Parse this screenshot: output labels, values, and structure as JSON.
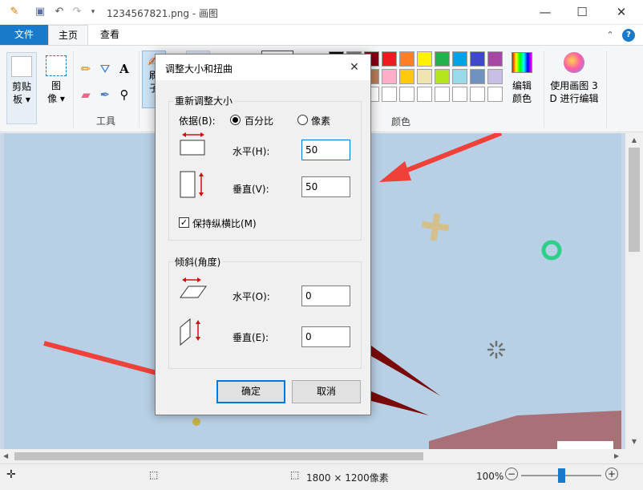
{
  "window": {
    "title": "1234567821.png - 画图",
    "minimize": "—",
    "maximize": "☐",
    "close": "✕"
  },
  "tabs": {
    "file": "文件",
    "home": "主页",
    "view": "查看"
  },
  "ribbon": {
    "clipboard": {
      "label_line1": "剪贴",
      "label_line2": "板 ▾"
    },
    "image": {
      "label_line1": "图",
      "label_line2": "像 ▾"
    },
    "tools_label": "工具",
    "brush_partial_1": "刷",
    "brush_partial_2": "子",
    "colors_label": "颜色",
    "edit_colors": {
      "line1": "编辑",
      "line2": "颜色"
    },
    "paint3d": {
      "line1": "使用画图 3",
      "line2": "D 进行编辑"
    },
    "palette_row1": [
      "#000000",
      "#7f7f7f",
      "#880015",
      "#ed1c24",
      "#ff7f27",
      "#fff200",
      "#22b14c",
      "#00a2e8",
      "#3f48cc",
      "#a349a4"
    ],
    "palette_row2": [
      "#ffffff",
      "#c3c3c3",
      "#b97a57",
      "#ffaec9",
      "#ffc90e",
      "#efe4b0",
      "#b5e61d",
      "#99d9ea",
      "#7092be",
      "#c8bfe7"
    ],
    "palette_row3": [
      "#ffffff",
      "#ffffff",
      "#ffffff",
      "#ffffff",
      "#ffffff",
      "#ffffff",
      "#ffffff",
      "#ffffff",
      "#ffffff",
      "#ffffff"
    ]
  },
  "dialog": {
    "title": "调整大小和扭曲",
    "resize_group": "重新调整大小",
    "by_label": "依据(B):",
    "percent": "百分比",
    "pixels": "像素",
    "horizontal_label": "水平(H):",
    "horizontal_value": "50",
    "vertical_label": "垂直(V):",
    "vertical_value": "50",
    "maintain_aspect": "保持纵横比(M)",
    "skew_group": "倾斜(角度)",
    "skew_horizontal_label": "水平(O):",
    "skew_horizontal_value": "0",
    "skew_vertical_label": "垂直(E):",
    "skew_vertical_value": "0",
    "ok": "确定",
    "cancel": "取消"
  },
  "status": {
    "dimensions": "1800 × 1200像素",
    "zoom": "100%"
  },
  "colors": {
    "accent": "#1979ca",
    "arrow": "#f0403a",
    "canvas": "#b8d0e6"
  }
}
